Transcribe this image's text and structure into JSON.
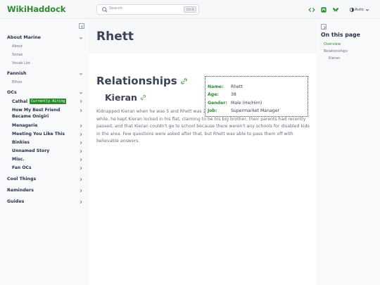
{
  "app": {
    "logo": "WikiHaddock"
  },
  "search": {
    "placeholder": "Search",
    "shortcut": "Ctrl K"
  },
  "toolbar": {
    "theme_label": "Auto"
  },
  "sidebar": {
    "sections": [
      {
        "label": "About Marine",
        "items": [
          "About",
          "Sonas",
          "Vocab List"
        ]
      },
      {
        "label": "Fannish",
        "items": [
          "Ethos"
        ]
      },
      {
        "label": "OCs",
        "items": [
          "Cathal",
          "How My Best Friend",
          "Became Onigiri",
          "Menagerie",
          "Meeting You Like This",
          "Binkies",
          "Unnamed Story",
          "Misc.",
          "Fan OCs"
        ],
        "badge": "Currently Airing"
      },
      {
        "label": "Cool Things"
      },
      {
        "label": "Reminders"
      },
      {
        "label": "Guides"
      }
    ]
  },
  "page": {
    "title": "Rhett",
    "section_heading": "Relationships",
    "subsection_heading": "Kieran",
    "body": "Kidnapped Kieran when he was 5 and Rhett was 20. He took him and skipped town. For the first while, he kept Kieran locked in his flat, claiming to be his big brother, their parents had recently passed, and that Kieran couldn't go to school because there weren't any schools for disabled kids in the area. Few questions were asked after that, but Rhett was able to pass them off with believable answers."
  },
  "infobox": {
    "rows": [
      {
        "key": "Name:",
        "value": "Rhett"
      },
      {
        "key": "Age:",
        "value": "38"
      },
      {
        "key": "Gender:",
        "value": "Male (He/Him)"
      },
      {
        "key": "Job:",
        "value": "Supermarket Manager"
      }
    ]
  },
  "toc": {
    "title": "On this page",
    "links": [
      "Overview",
      "Relationships",
      "Kieran"
    ]
  },
  "colors": {
    "accent": "#2e8a2e",
    "text": "#3c4257",
    "muted": "#6b7080",
    "sidebar_bg": "#f8f9fb"
  }
}
